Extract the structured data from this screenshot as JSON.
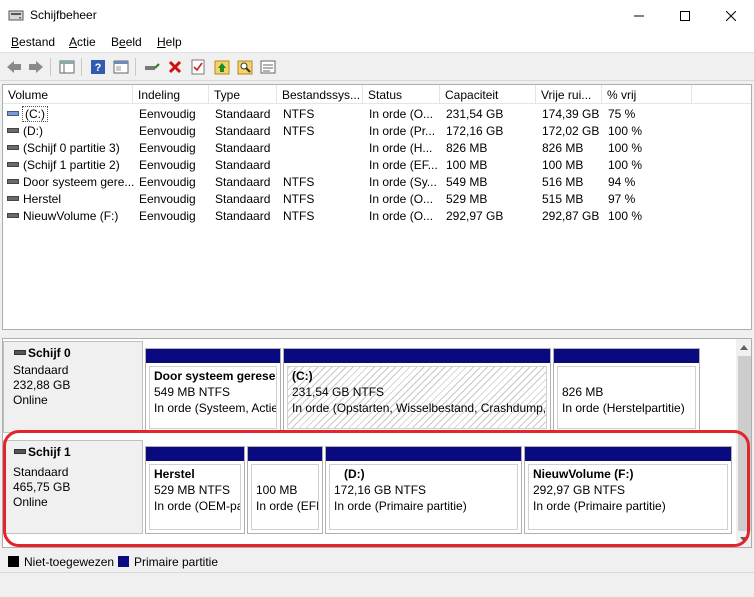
{
  "window": {
    "title": "Schijfbeheer",
    "icon": "disk-management-icon"
  },
  "menu": [
    {
      "label": "Bestand",
      "accel": "B"
    },
    {
      "label": "Actie",
      "accel": "A"
    },
    {
      "label": "Beeld",
      "accel": "e"
    },
    {
      "label": "Help",
      "accel": "H"
    }
  ],
  "toolbar": {
    "icons": [
      "back-arrow-icon",
      "forward-arrow-icon",
      "properties-pane-icon",
      "help-icon",
      "show-hide-pane-icon",
      "connect-icon",
      "delete-icon",
      "checklist-icon",
      "import-icon",
      "search-icon",
      "list-view-icon"
    ]
  },
  "volumes": {
    "columns": [
      "Volume",
      "Indeling",
      "Type",
      "Bestandssys...",
      "Status",
      "Capaciteit",
      "Vrije rui...",
      "% vrij"
    ],
    "rows": [
      {
        "volume": "(C:)",
        "indeling": "Eenvoudig",
        "type": "Standaard",
        "fs": "NTFS",
        "status": "In orde (O...",
        "capacity": "231,54 GB",
        "free": "174,39 GB",
        "pct": "75 %"
      },
      {
        "volume": "(D:)",
        "indeling": "Eenvoudig",
        "type": "Standaard",
        "fs": "NTFS",
        "status": "In orde (Pr...",
        "capacity": "172,16 GB",
        "free": "172,02 GB",
        "pct": "100 %"
      },
      {
        "volume": "(Schijf 0 partitie 3)",
        "indeling": "Eenvoudig",
        "type": "Standaard",
        "fs": "",
        "status": "In orde (H...",
        "capacity": "826 MB",
        "free": "826 MB",
        "pct": "100 %"
      },
      {
        "volume": "(Schijf 1 partitie 2)",
        "indeling": "Eenvoudig",
        "type": "Standaard",
        "fs": "",
        "status": "In orde (EF...",
        "capacity": "100 MB",
        "free": "100 MB",
        "pct": "100 %"
      },
      {
        "volume": "Door systeem gere...",
        "indeling": "Eenvoudig",
        "type": "Standaard",
        "fs": "NTFS",
        "status": "In orde (Sy...",
        "capacity": "549 MB",
        "free": "516 MB",
        "pct": "94 %"
      },
      {
        "volume": "Herstel",
        "indeling": "Eenvoudig",
        "type": "Standaard",
        "fs": "NTFS",
        "status": "In orde (O...",
        "capacity": "529 MB",
        "free": "515 MB",
        "pct": "97 %"
      },
      {
        "volume": "NieuwVolume (F:)",
        "indeling": "Eenvoudig",
        "type": "Standaard",
        "fs": "NTFS",
        "status": "In orde (O...",
        "capacity": "292,97 GB",
        "free": "292,87 GB",
        "pct": "100 %"
      }
    ]
  },
  "disks": [
    {
      "name": "Schijf 0",
      "kind": "Standaard",
      "size": "232,88 GB",
      "state": "Online",
      "partitions": [
        {
          "name": "Door systeem gereser",
          "size": "549 MB NTFS",
          "status": "In orde (Systeem, Actie"
        },
        {
          "name": "(C:)",
          "size": "231,54 GB NTFS",
          "status": "In orde (Opstarten, Wisselbestand, Crashdump, P"
        },
        {
          "name": "",
          "size": "826 MB",
          "status": "In orde (Herstelpartitie)"
        }
      ]
    },
    {
      "name": "Schijf 1",
      "kind": "Standaard",
      "size": "465,75 GB",
      "state": "Online",
      "partitions": [
        {
          "name": "Herstel",
          "size": "529 MB NTFS",
          "status": "In orde (OEM-pa"
        },
        {
          "name": "",
          "size": "100 MB",
          "status": "In orde (EFI"
        },
        {
          "name": "(D:)",
          "size": "172,16 GB NTFS",
          "status": "In orde (Primaire partitie)"
        },
        {
          "name": "NieuwVolume  (F:)",
          "size": "292,97 GB NTFS",
          "status": "In orde (Primaire partitie)"
        }
      ]
    }
  ],
  "legend": [
    {
      "label": "Niet-toegewezen",
      "color": "#000000"
    },
    {
      "label": "Primaire partitie",
      "color": "#0a0a80"
    }
  ],
  "colors": {
    "partition_bar": "#0a0a80",
    "highlight": "#e3242b"
  }
}
